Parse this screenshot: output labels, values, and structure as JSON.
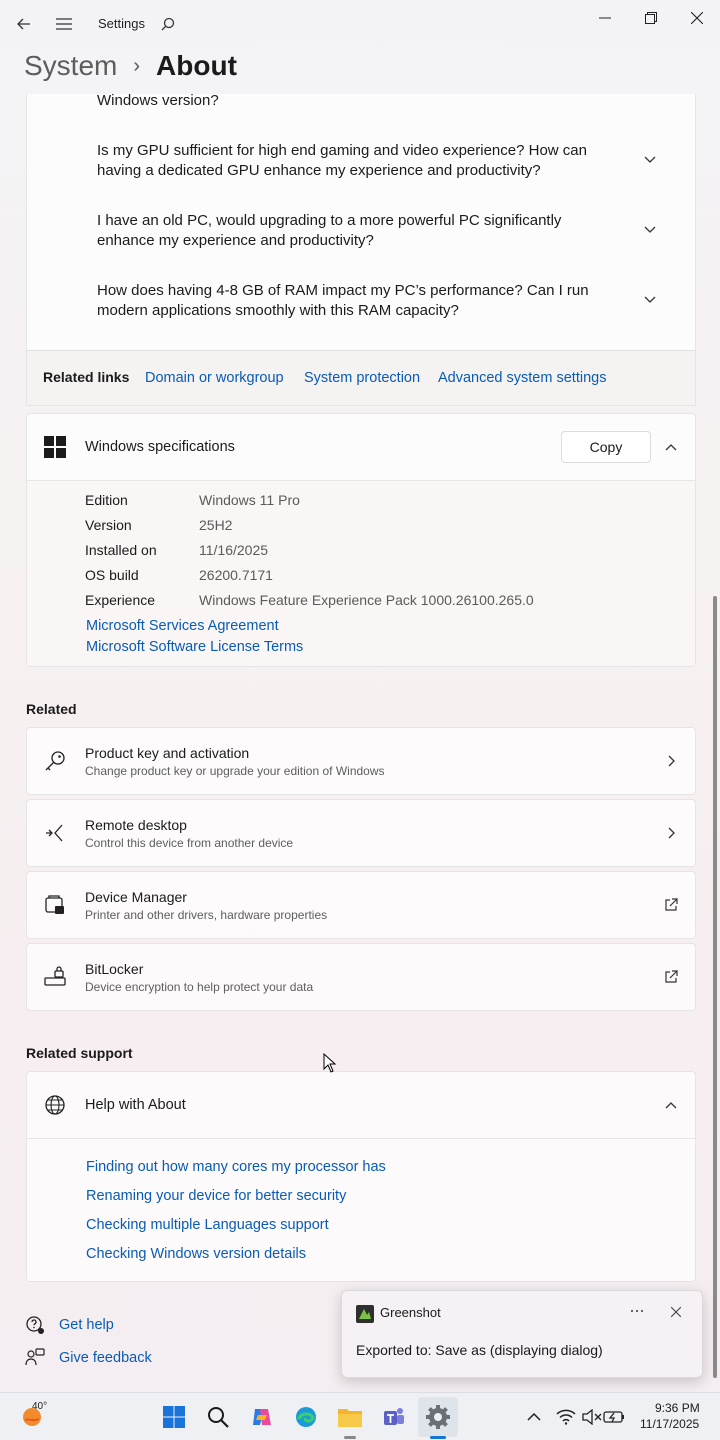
{
  "titlebar": {
    "title": "Settings"
  },
  "breadcrumb": {
    "parent": "System",
    "separator": "›",
    "current": "About"
  },
  "faq": {
    "partial": "Windows version?",
    "items": [
      {
        "text": "Is my GPU sufficient for high end gaming and video experience? How can having a dedicated GPU enhance my experience and productivity?"
      },
      {
        "text": "I have an old PC, would upgrading to a more powerful PC significantly enhance my experience and productivity?"
      },
      {
        "text": "How does having 4-8 GB of RAM impact my PC’s performance? Can I run modern applications smoothly with this RAM capacity?"
      }
    ]
  },
  "related_links": {
    "label": "Related links",
    "links": [
      "Domain or workgroup",
      "System protection",
      "Advanced system settings"
    ]
  },
  "windows_specs": {
    "title": "Windows specifications",
    "copy_label": "Copy",
    "rows": [
      {
        "label": "Edition",
        "value": "Windows 11 Pro"
      },
      {
        "label": "Version",
        "value": "25H2"
      },
      {
        "label": "Installed on",
        "value": "11/16/2025"
      },
      {
        "label": "OS build",
        "value": "26200.7171"
      },
      {
        "label": "Experience",
        "value": "Windows Feature Experience Pack 1000.26100.265.0"
      }
    ],
    "links": [
      "Microsoft Services Agreement",
      "Microsoft Software License Terms"
    ]
  },
  "related": {
    "heading": "Related",
    "items": [
      {
        "title": "Product key and activation",
        "subtitle": "Change product key or upgrade your edition of Windows",
        "icon": "key-icon"
      },
      {
        "title": "Remote desktop",
        "subtitle": "Control this device from another device",
        "icon": "remote-desktop-icon"
      },
      {
        "title": "Device Manager",
        "subtitle": "Printer and other drivers, hardware properties",
        "icon": "device-manager-icon"
      },
      {
        "title": "BitLocker",
        "subtitle": "Device encryption to help protect your data",
        "icon": "bitlocker-icon"
      }
    ]
  },
  "related_support": {
    "heading": "Related support",
    "help_title": "Help with About",
    "links": [
      "Finding out how many cores my processor has",
      "Renaming your device for better security",
      "Checking multiple Languages support",
      "Checking Windows version details"
    ]
  },
  "footer": {
    "get_help": "Get help",
    "give_feedback": "Give feedback"
  },
  "toast": {
    "app": "Greenshot",
    "message": "Exported to: Save as (displaying dialog)"
  },
  "taskbar": {
    "weather": "40°",
    "time": "9:36 PM",
    "date": "11/17/2025"
  }
}
